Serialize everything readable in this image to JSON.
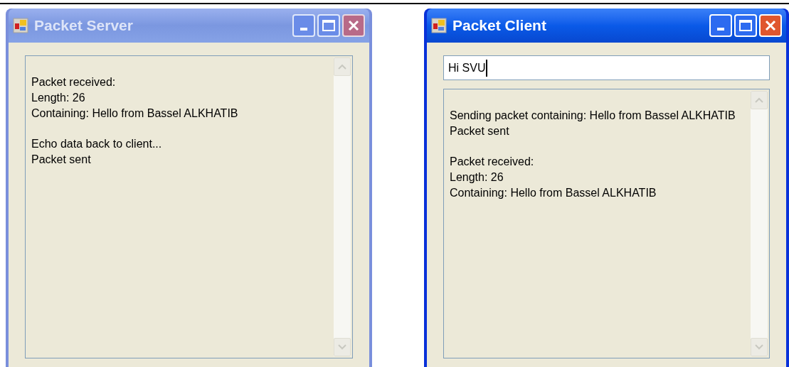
{
  "windows": [
    {
      "title": "Packet Server",
      "active": false,
      "log": [
        [
          "Packet received:",
          "Length: 26",
          "Containing: Hello from Bassel ALKHATIB"
        ],
        [
          "Echo data back to client...",
          "Packet sent"
        ]
      ]
    },
    {
      "title": "Packet Client",
      "active": true,
      "input": {
        "value": "Hi SVU"
      },
      "log": [
        [
          "Sending packet containing: Hello from Bassel ALKHATIB",
          "Packet sent"
        ],
        [
          "Packet received:",
          "Length: 26",
          "Containing: Hello from Bassel ALKHATIB"
        ]
      ]
    }
  ]
}
